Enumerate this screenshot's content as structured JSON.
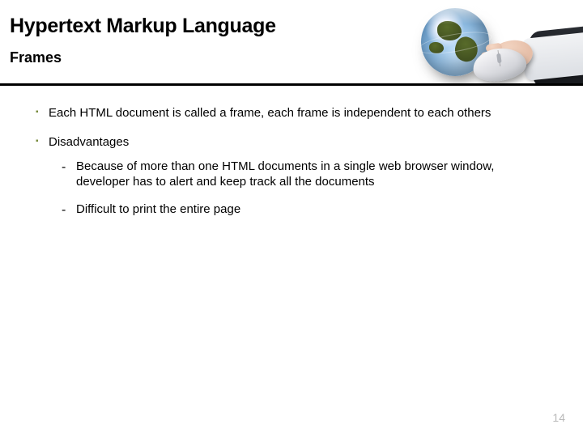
{
  "header": {
    "title": "Hypertext Markup Language",
    "subtitle": "Frames"
  },
  "bullets": [
    {
      "text": "Each HTML document is called a frame, each frame is independent to each others",
      "subs": []
    },
    {
      "text": "Disadvantages",
      "subs": [
        "Because of more than one HTML documents in a single web browser window, developer has to alert and keep track all the documents",
        "Difficult to print the entire page"
      ]
    }
  ],
  "page_number": "14"
}
